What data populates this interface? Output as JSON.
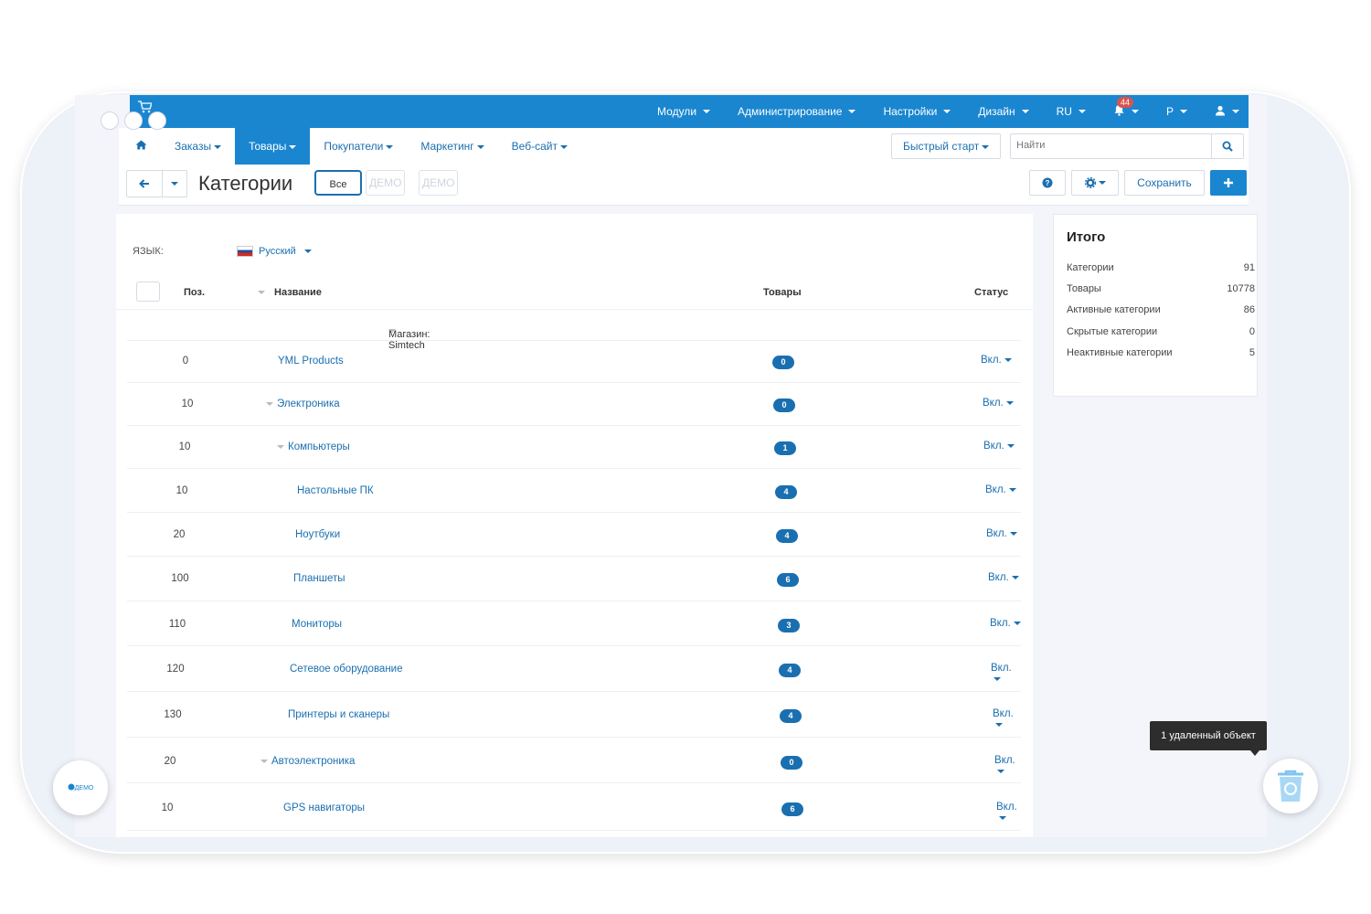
{
  "topbar": {
    "menu": [
      {
        "label": "Модули"
      },
      {
        "label": "Администрирование"
      },
      {
        "label": "Настройки"
      },
      {
        "label": "Дизайн"
      },
      {
        "label": "RU"
      }
    ],
    "notifications_count": "44",
    "currency": "Р"
  },
  "mainnav": {
    "tabs": [
      {
        "label": "Заказы"
      },
      {
        "label": "Товары"
      },
      {
        "label": "Покупатели"
      },
      {
        "label": "Маркетинг"
      },
      {
        "label": "Веб-сайт"
      }
    ],
    "quickstart_label": "Быстрый старт",
    "search_placeholder": "Найти"
  },
  "toolbar": {
    "title": "Категории",
    "filter_all": "Все",
    "demo_chip_1": "ДЕМО",
    "demo_chip_2": "ДЕМО",
    "save_label": "Сохранить"
  },
  "language": {
    "label": "ЯЗЫК:",
    "value": "Русский"
  },
  "table": {
    "headers": {
      "pos": "Поз.",
      "name": "Название",
      "goods": "Товары",
      "status": "Статус"
    },
    "store": "Магазин: Simtech",
    "rows": [
      {
        "pos": "0",
        "name": "YML Products",
        "count": "0",
        "status": "Вкл."
      },
      {
        "pos": "10",
        "name": "Электроника",
        "count": "0",
        "status": "Вкл."
      },
      {
        "pos": "10",
        "name": "Компьютеры",
        "count": "1",
        "status": "Вкл."
      },
      {
        "pos": "10",
        "name": "Настольные ПК",
        "count": "4",
        "status": "Вкл."
      },
      {
        "pos": "20",
        "name": "Ноутбуки",
        "count": "4",
        "status": "Вкл."
      },
      {
        "pos": "100",
        "name": "Планшеты",
        "count": "6",
        "status": "Вкл."
      },
      {
        "pos": "110",
        "name": "Мониторы",
        "count": "3",
        "status": "Вкл."
      },
      {
        "pos": "120",
        "name": "Сетевое оборудование",
        "count": "4",
        "status": "Вкл."
      },
      {
        "pos": "130",
        "name": "Принтеры и сканеры",
        "count": "4",
        "status": "Вкл."
      },
      {
        "pos": "20",
        "name": "Автоэлектроника",
        "count": "0",
        "status": "Вкл."
      },
      {
        "pos": "10",
        "name": "GPS навигаторы",
        "count": "6",
        "status": "Вкл."
      }
    ]
  },
  "totals": {
    "title": "Итого",
    "items": [
      {
        "label": "Категории",
        "value": "91"
      },
      {
        "label": "Товары",
        "value": "10778"
      },
      {
        "label": "Активные категории",
        "value": "86"
      },
      {
        "label": "Скрытые категории",
        "value": "0"
      },
      {
        "label": "Неактивные категории",
        "value": "5"
      }
    ]
  },
  "trash": {
    "tooltip": "1 удаленный объект"
  },
  "demo_badge": "ДЕМО",
  "colors": {
    "accent": "#1a86d0",
    "link": "#1a6fb0"
  },
  "icons": [
    "cart-icon",
    "home-icon",
    "bell-icon",
    "user-icon",
    "search-icon",
    "back-arrow-icon",
    "help-icon",
    "gear-icon",
    "plus-icon",
    "trash-icon"
  ]
}
